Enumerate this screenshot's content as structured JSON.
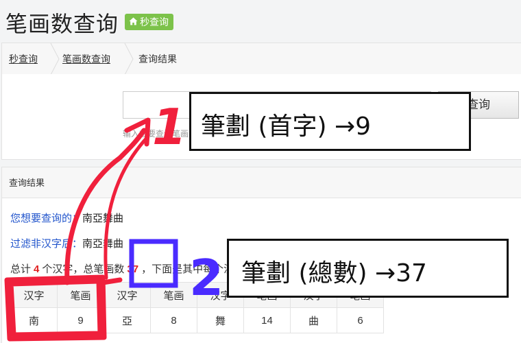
{
  "header": {
    "title": "笔画数查询",
    "badge": "秒查询",
    "badge_icon": "home-icon"
  },
  "breadcrumb": {
    "items": [
      "秒查询",
      "笔画数查询",
      "查询结果"
    ]
  },
  "search": {
    "button": "查询",
    "hint": "输入想要查询笔画的汉字（简体字、繁体字均可），不超过10个"
  },
  "result": {
    "heading": "查询结果",
    "query_label": "您想要查询的：",
    "query_value": "南亞舞曲",
    "filter_label": "过滤非汉字后：",
    "filter_value": "南亞舞曲",
    "summary_1": "总计",
    "char_count": "4",
    "summary_2": "个汉字，总笔画数",
    "total_strokes": "37",
    "summary_3": "，下面是其中每个汉字的笔画数，点击汉字可查看其详细解释：",
    "table": {
      "headers": [
        "汉字",
        "笔画",
        "汉字",
        "笔画",
        "汉字",
        "笔画",
        "汉字",
        "笔画"
      ],
      "row": [
        "南",
        "9",
        "亞",
        "8",
        "舞",
        "14",
        "曲",
        "6"
      ]
    }
  },
  "annotations": {
    "number_1": "1",
    "number_2": "2",
    "box_1_text": "筆劃 (首字) →9",
    "box_2_text": "筆劃 (總數) →37",
    "red": "#f0203c",
    "blue": "#4a2bff"
  }
}
